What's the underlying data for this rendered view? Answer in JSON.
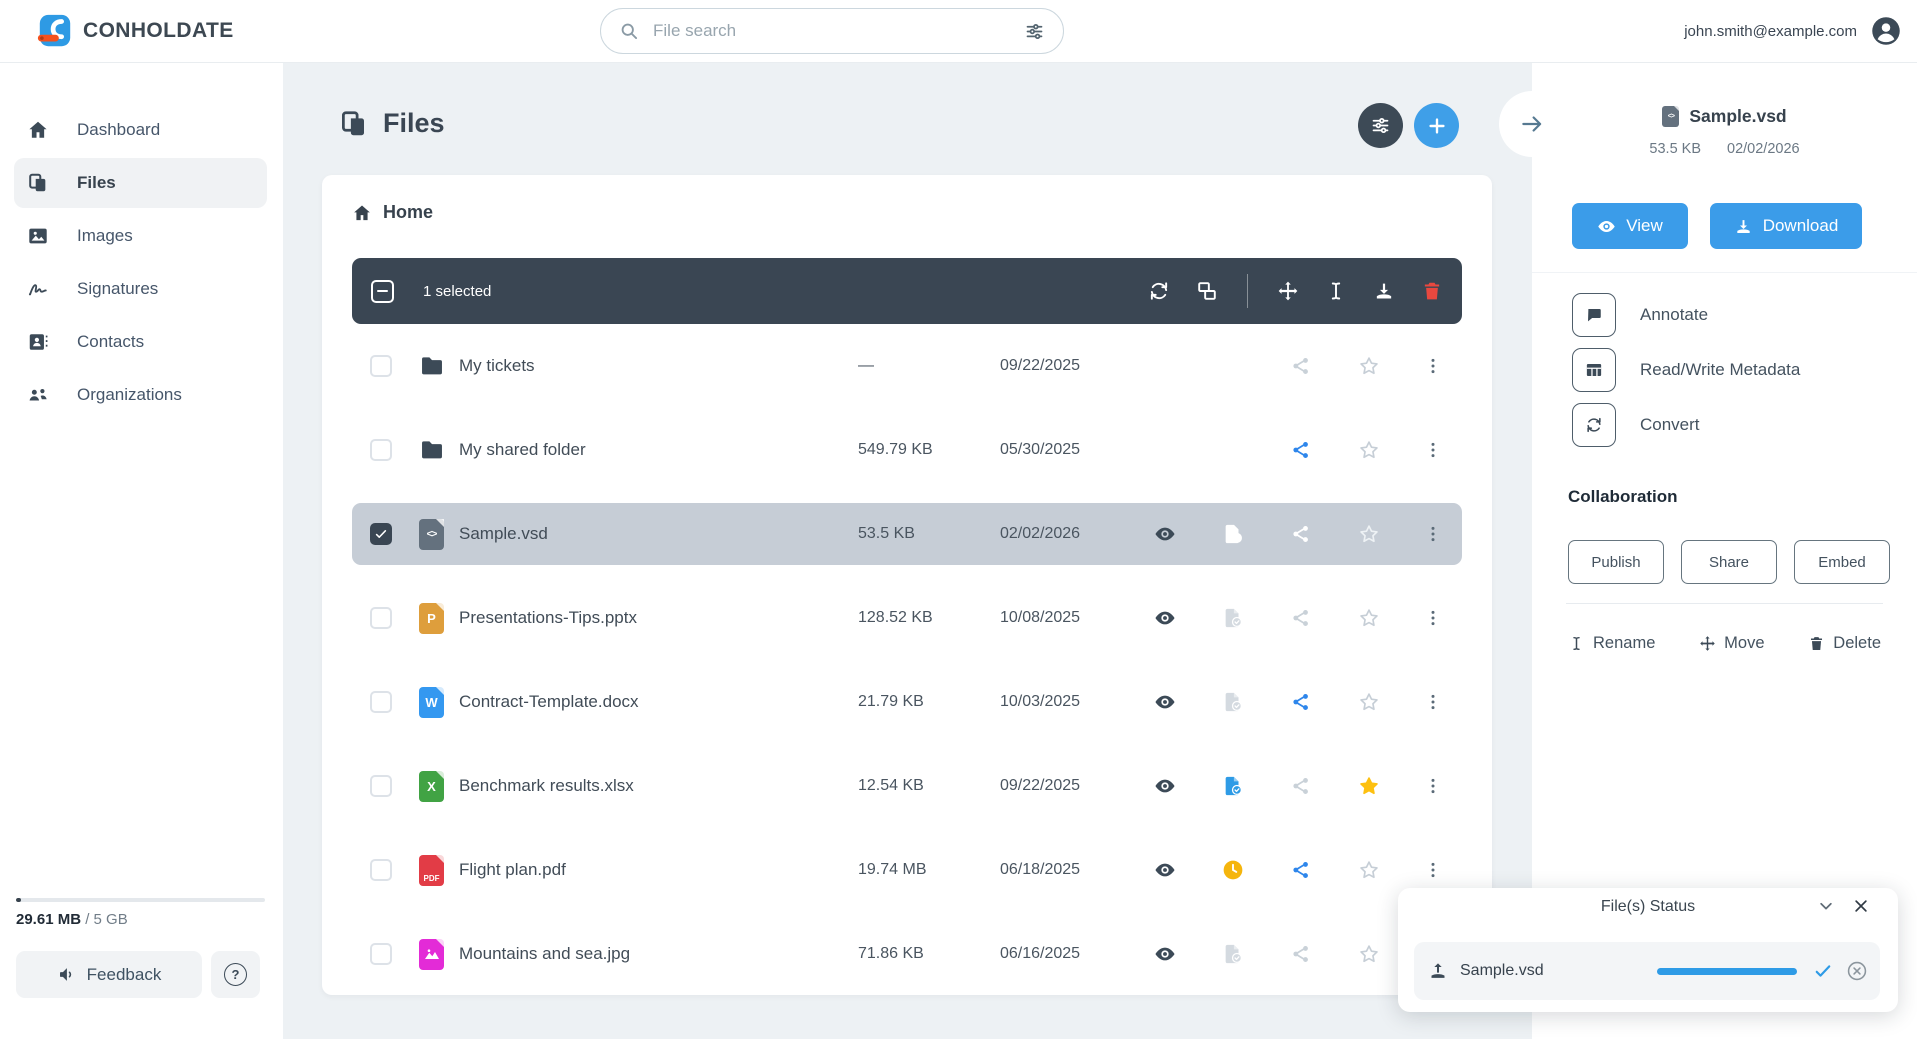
{
  "colors": {
    "accent": "#3b9ce9",
    "toolbar_dark": "#3a4653",
    "selected_row": "#c6cdd6",
    "star_active": "#fdc010",
    "clock_status": "#f5b50d",
    "danger": "#e8483f",
    "share_active": "#2e86eb",
    "muted_icon": "#ccd4db"
  },
  "topbar": {
    "logo_text": "CONHOLDATE",
    "search_placeholder": "File search",
    "user_email": "john.smith@example.com"
  },
  "sidebar": {
    "items": [
      {
        "label": "Dashboard",
        "icon": "home",
        "active": false
      },
      {
        "label": "Files",
        "icon": "files",
        "active": true
      },
      {
        "label": "Images",
        "icon": "image",
        "active": false
      },
      {
        "label": "Signatures",
        "icon": "signature",
        "active": false
      },
      {
        "label": "Contacts",
        "icon": "contact",
        "active": false
      },
      {
        "label": "Organizations",
        "icon": "people",
        "active": false
      }
    ],
    "storage_used": "29.61 MB",
    "storage_total": " / 5 GB",
    "feedback_label": "Feedback",
    "help_label": "?"
  },
  "main": {
    "title": "Files",
    "breadcrumb": "Home",
    "selection_bar": {
      "label": "1 selected",
      "actions": [
        {
          "id": "convert",
          "icon": "refresh"
        },
        {
          "id": "combine",
          "icon": "combine"
        },
        {
          "id": "divider"
        },
        {
          "id": "move",
          "icon": "move"
        },
        {
          "id": "rename",
          "icon": "ibeam"
        },
        {
          "id": "download",
          "icon": "download"
        },
        {
          "id": "delete",
          "icon": "trash"
        }
      ]
    },
    "rows": [
      {
        "kind": "folder",
        "name": "My tickets",
        "size": "—",
        "date": "09/22/2025",
        "selected": false,
        "eye": false,
        "status": "none",
        "share": "muted",
        "star": "off"
      },
      {
        "kind": "folder",
        "name": "My shared folder",
        "size": "549.79 KB",
        "date": "05/30/2025",
        "selected": false,
        "eye": false,
        "status": "none",
        "share": "active",
        "star": "off"
      },
      {
        "kind": "vsd",
        "name": "Sample.vsd",
        "size": "53.5 KB",
        "date": "02/02/2026",
        "selected": true,
        "eye": true,
        "status": "check-light",
        "share": "light",
        "star": "off"
      },
      {
        "kind": "pptx",
        "name": "Presentations-Tips.pptx",
        "size": "128.52 KB",
        "date": "10/08/2025",
        "selected": false,
        "eye": true,
        "status": "check-muted",
        "share": "muted",
        "star": "off"
      },
      {
        "kind": "docx",
        "name": "Contract-Template.docx",
        "size": "21.79 KB",
        "date": "10/03/2025",
        "selected": false,
        "eye": true,
        "status": "check-muted",
        "share": "active",
        "star": "off"
      },
      {
        "kind": "xlsx",
        "name": "Benchmark results.xlsx",
        "size": "12.54 KB",
        "date": "09/22/2025",
        "selected": false,
        "eye": true,
        "status": "check-active",
        "share": "muted",
        "star": "on"
      },
      {
        "kind": "pdf",
        "name": "Flight plan.pdf",
        "size": "19.74 MB",
        "date": "06/18/2025",
        "selected": false,
        "eye": true,
        "status": "clock",
        "share": "active",
        "star": "off"
      },
      {
        "kind": "jpg",
        "name": "Mountains and sea.jpg",
        "size": "71.86 KB",
        "date": "06/16/2025",
        "selected": false,
        "eye": true,
        "status": "check-muted",
        "share": "muted",
        "star": "off"
      }
    ]
  },
  "details": {
    "file_name": "Sample.vsd",
    "file_size": "53.5 KB",
    "file_date": "02/02/2026",
    "view_label": "View",
    "download_label": "Download",
    "actions": [
      {
        "icon": "chat",
        "label": "Annotate"
      },
      {
        "icon": "table",
        "label": "Read/Write Metadata"
      },
      {
        "icon": "refresh",
        "label": "Convert"
      }
    ],
    "collaboration_title": "Collaboration",
    "collab_buttons": [
      "Publish",
      "Share",
      "Embed"
    ],
    "footer_actions": [
      {
        "icon": "ibeam",
        "label": "Rename"
      },
      {
        "icon": "move",
        "label": "Move"
      },
      {
        "icon": "trash",
        "label": "Delete"
      }
    ]
  },
  "popup": {
    "title": "File(s) Status",
    "file_name": "Sample.vsd",
    "progress_percent": 100
  }
}
